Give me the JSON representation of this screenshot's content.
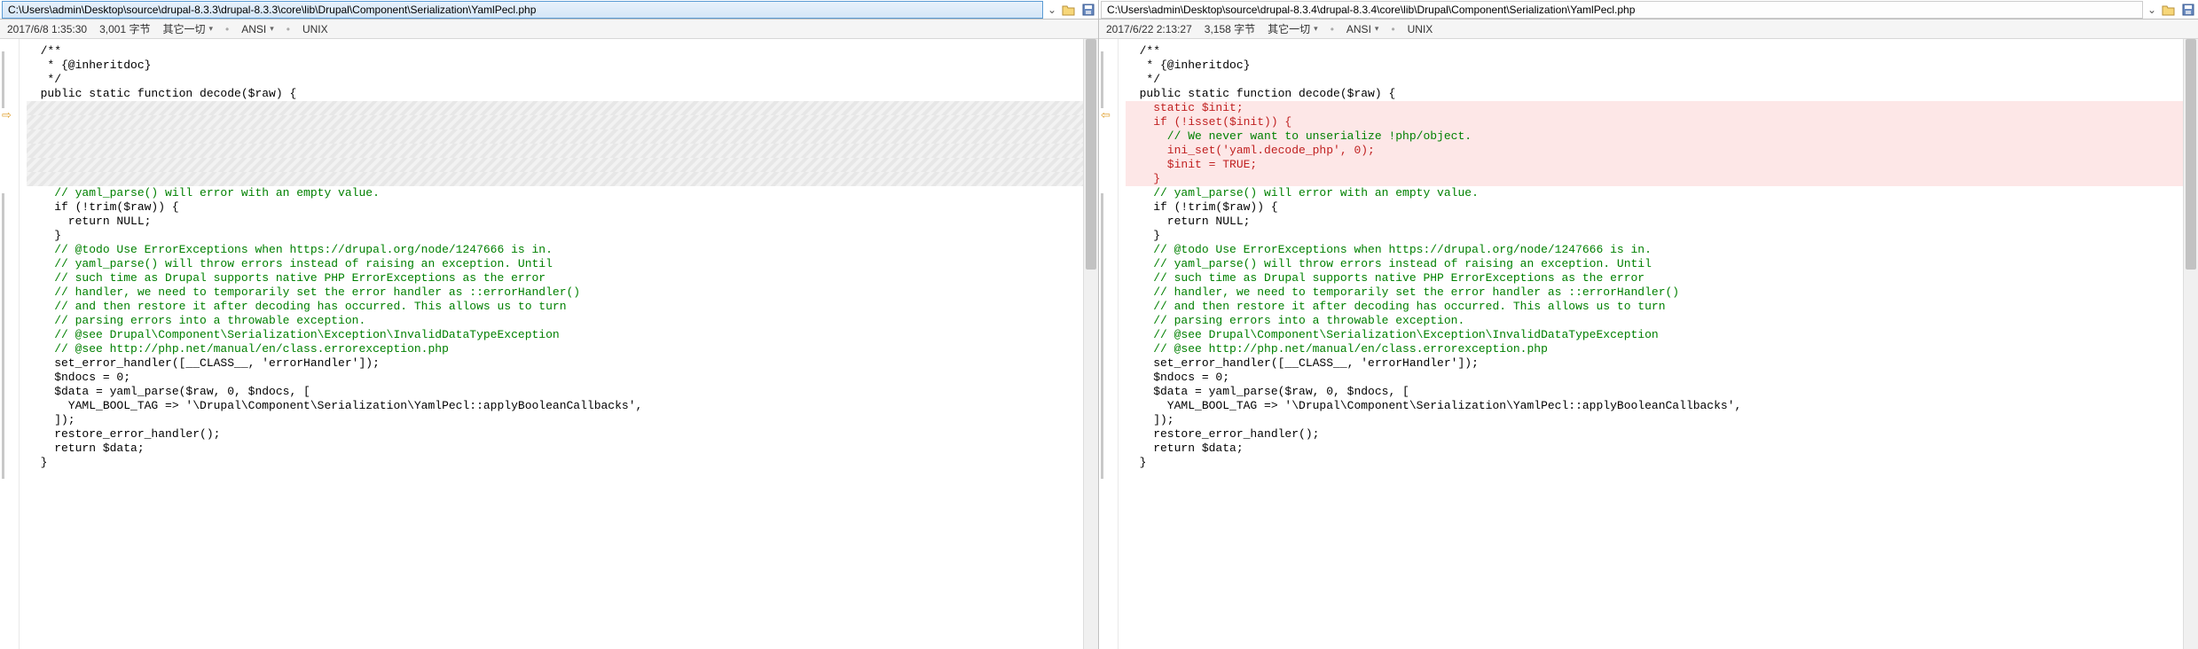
{
  "labels": {
    "bytes_suffix": " 字节",
    "misc_label": "其它一切"
  },
  "encoding": {
    "ansi": "ANSI",
    "unix": "UNIX"
  },
  "left": {
    "path": "C:\\Users\\admin\\Desktop\\source\\drupal-8.3.3\\drupal-8.3.3\\core\\lib\\Drupal\\Component\\Serialization\\YamlPecl.php",
    "timestamp": "2017/6/8 1:35:30",
    "bytes": "3,001",
    "code": [
      {
        "t": "  /**"
      },
      {
        "t": "   * {@inheritdoc}"
      },
      {
        "t": "   */"
      },
      {
        "t": "  public static function decode($raw) {"
      },
      {
        "t": "",
        "cls": "diff-hatch"
      },
      {
        "t": "",
        "cls": "diff-hatch"
      },
      {
        "t": "",
        "cls": "diff-hatch"
      },
      {
        "t": "",
        "cls": "diff-hatch"
      },
      {
        "t": "",
        "cls": "diff-hatch"
      },
      {
        "t": "",
        "cls": "diff-hatch"
      },
      {
        "t": "    // yaml_parse() will error with an empty value.",
        "cls": "cmt"
      },
      {
        "t": "    if (!trim($raw)) {"
      },
      {
        "t": "      return NULL;"
      },
      {
        "t": "    }"
      },
      {
        "t": "    // @todo Use ErrorExceptions when https://drupal.org/node/1247666 is in.",
        "cls": "cmt"
      },
      {
        "t": "    // yaml_parse() will throw errors instead of raising an exception. Until",
        "cls": "cmt"
      },
      {
        "t": "    // such time as Drupal supports native PHP ErrorExceptions as the error",
        "cls": "cmt"
      },
      {
        "t": "    // handler, we need to temporarily set the error handler as ::errorHandler()",
        "cls": "cmt"
      },
      {
        "t": "    // and then restore it after decoding has occurred. This allows us to turn",
        "cls": "cmt"
      },
      {
        "t": "    // parsing errors into a throwable exception.",
        "cls": "cmt"
      },
      {
        "t": "    // @see Drupal\\Component\\Serialization\\Exception\\InvalidDataTypeException",
        "cls": "cmt"
      },
      {
        "t": "    // @see http://php.net/manual/en/class.errorexception.php",
        "cls": "cmt"
      },
      {
        "t": "    set_error_handler([__CLASS__, 'errorHandler']);"
      },
      {
        "t": "    $ndocs = 0;"
      },
      {
        "t": "    $data = yaml_parse($raw, 0, $ndocs, ["
      },
      {
        "t": "      YAML_BOOL_TAG => '\\Drupal\\Component\\Serialization\\YamlPecl::applyBooleanCallbacks',"
      },
      {
        "t": "    ]);"
      },
      {
        "t": "    restore_error_handler();"
      },
      {
        "t": "    return $data;"
      },
      {
        "t": "  }"
      }
    ]
  },
  "right": {
    "path": "C:\\Users\\admin\\Desktop\\source\\drupal-8.3.4\\drupal-8.3.4\\core\\lib\\Drupal\\Component\\Serialization\\YamlPecl.php",
    "timestamp": "2017/6/22 2:13:27",
    "bytes": "3,158",
    "code": [
      {
        "t": "  /**"
      },
      {
        "t": "   * {@inheritdoc}"
      },
      {
        "t": "   */"
      },
      {
        "t": "  public static function decode($raw) {"
      },
      {
        "t": "    static $init;",
        "cls": "diff-add"
      },
      {
        "t": "    if (!isset($init)) {",
        "cls": "diff-add"
      },
      {
        "t": "      // We never want to unserialize !php/object.",
        "cls": "diff-add cmt"
      },
      {
        "t": "      ini_set('yaml.decode_php', 0);",
        "cls": "diff-add"
      },
      {
        "t": "      $init = TRUE;",
        "cls": "diff-add"
      },
      {
        "t": "    }",
        "cls": "diff-add"
      },
      {
        "t": "    // yaml_parse() will error with an empty value.",
        "cls": "cmt"
      },
      {
        "t": "    if (!trim($raw)) {"
      },
      {
        "t": "      return NULL;"
      },
      {
        "t": "    }"
      },
      {
        "t": "    // @todo Use ErrorExceptions when https://drupal.org/node/1247666 is in.",
        "cls": "cmt"
      },
      {
        "t": "    // yaml_parse() will throw errors instead of raising an exception. Until",
        "cls": "cmt"
      },
      {
        "t": "    // such time as Drupal supports native PHP ErrorExceptions as the error",
        "cls": "cmt"
      },
      {
        "t": "    // handler, we need to temporarily set the error handler as ::errorHandler()",
        "cls": "cmt"
      },
      {
        "t": "    // and then restore it after decoding has occurred. This allows us to turn",
        "cls": "cmt"
      },
      {
        "t": "    // parsing errors into a throwable exception.",
        "cls": "cmt"
      },
      {
        "t": "    // @see Drupal\\Component\\Serialization\\Exception\\InvalidDataTypeException",
        "cls": "cmt"
      },
      {
        "t": "    // @see http://php.net/manual/en/class.errorexception.php",
        "cls": "cmt"
      },
      {
        "t": "    set_error_handler([__CLASS__, 'errorHandler']);"
      },
      {
        "t": "    $ndocs = 0;"
      },
      {
        "t": "    $data = yaml_parse($raw, 0, $ndocs, ["
      },
      {
        "t": "      YAML_BOOL_TAG => '\\Drupal\\Component\\Serialization\\YamlPecl::applyBooleanCallbacks',"
      },
      {
        "t": "    ]);"
      },
      {
        "t": "    restore_error_handler();"
      },
      {
        "t": "    return $data;"
      },
      {
        "t": "  }"
      }
    ]
  }
}
